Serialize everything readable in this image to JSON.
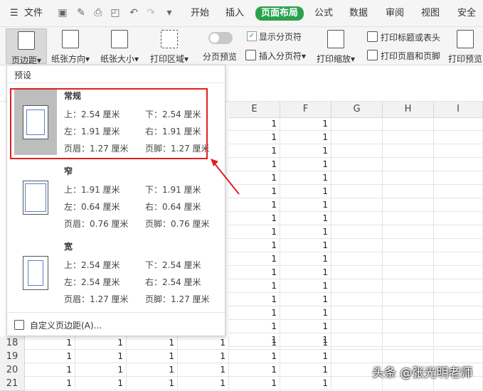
{
  "menubar": {
    "file": "文件",
    "tabs": [
      "开始",
      "插入",
      "页面布局",
      "公式",
      "数据",
      "审阅",
      "视图",
      "安全"
    ],
    "active_tab": "页面布局"
  },
  "ribbon": {
    "margins": "页边距",
    "orientation": "纸张方向",
    "size": "纸张大小",
    "print_area": "打印区域",
    "page_break_preview": "分页预览",
    "show_page_breaks": "显示分页符",
    "insert_page_break": "插入分页符",
    "print_scale": "打印缩放",
    "print_titles": "打印标题或表头",
    "print_header_footer": "打印页眉和页脚",
    "print_preview": "打印预览"
  },
  "sheet": {
    "columns": [
      "E",
      "F",
      "G",
      "H",
      "I"
    ],
    "rows": [
      "18",
      "19",
      "20",
      "21"
    ],
    "cell_value": "1"
  },
  "dropdown": {
    "title": "预设",
    "presets": [
      {
        "name": "常规",
        "top": "上：2.54 厘米",
        "bottom": "下：2.54 厘米",
        "left": "左：1.91 厘米",
        "right": "右：1.91 厘米",
        "header": "页眉：1.27 厘米",
        "footer": "页脚：1.27 厘米"
      },
      {
        "name": "窄",
        "top": "上：1.91 厘米",
        "bottom": "下：1.91 厘米",
        "left": "左：0.64 厘米",
        "right": "右：0.64 厘米",
        "header": "页眉：0.76 厘米",
        "footer": "页脚：0.76 厘米"
      },
      {
        "name": "宽",
        "top": "上：2.54 厘米",
        "bottom": "下：2.54 厘米",
        "left": "左：2.54 厘米",
        "right": "右：2.54 厘米",
        "header": "页眉：1.27 厘米",
        "footer": "页脚：1.27 厘米"
      }
    ],
    "custom": "自定义页边距(A)..."
  },
  "watermark": "头条 @张光明老师"
}
